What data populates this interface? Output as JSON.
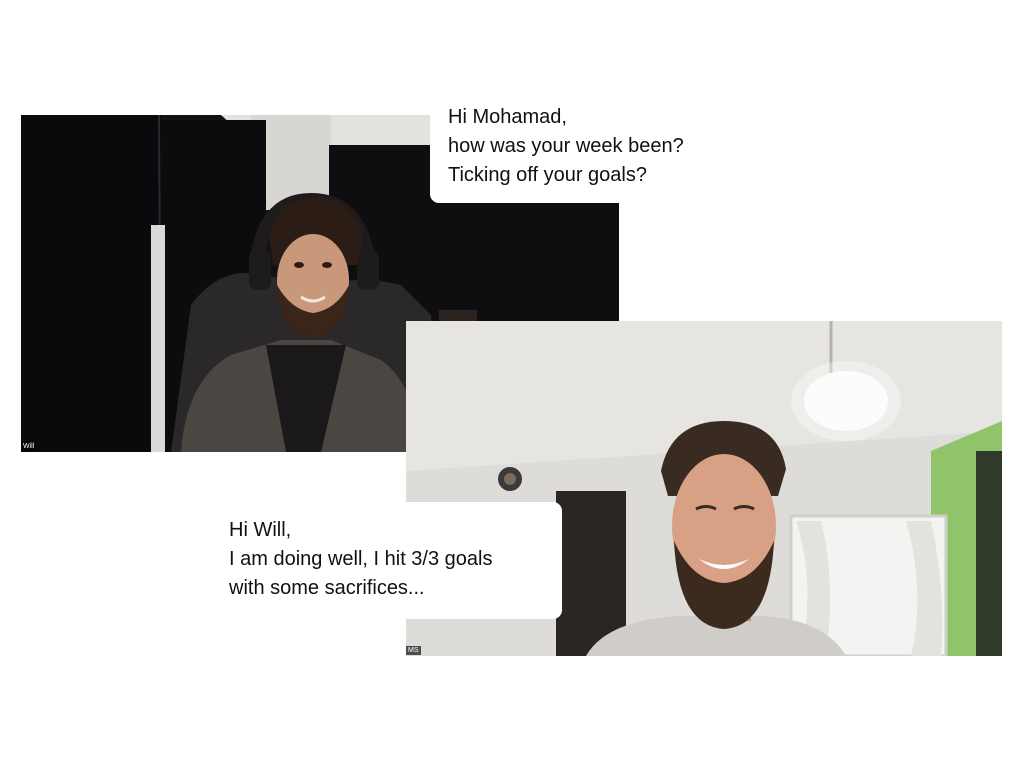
{
  "participants": [
    {
      "name_tag": "Will",
      "message_lines": [
        "Hi Mohamad,",
        "how was your week been?",
        "Ticking off your goals?"
      ]
    },
    {
      "name_tag": "MS",
      "message_lines": [
        "Hi Will,",
        "I am doing well, I hit 3/3 goals",
        "with some sacrifices..."
      ]
    }
  ]
}
